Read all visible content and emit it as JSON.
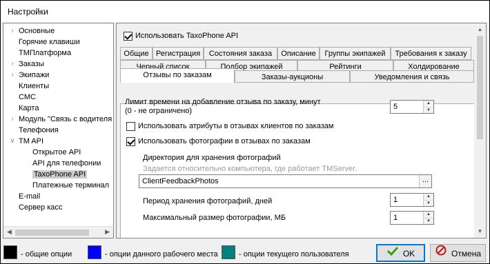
{
  "window": {
    "title": "Настройки"
  },
  "tree": {
    "items": [
      {
        "label": "Основные",
        "expandable": true,
        "expanded": false
      },
      {
        "label": "Горячие клавиши",
        "expandable": false
      },
      {
        "label": "TMПлатформа",
        "expandable": false
      },
      {
        "label": "Заказы",
        "expandable": true,
        "expanded": false
      },
      {
        "label": "Экипажи",
        "expandable": true,
        "expanded": false
      },
      {
        "label": "Клиенты",
        "expandable": false
      },
      {
        "label": "СМС",
        "expandable": false
      },
      {
        "label": "Карта",
        "expandable": false
      },
      {
        "label": "Модуль \"Связь с водителя",
        "expandable": true,
        "expanded": false
      },
      {
        "label": "Телефония",
        "expandable": false
      },
      {
        "label": "TM API",
        "expandable": true,
        "expanded": true
      },
      {
        "label": "Открытое API",
        "expandable": false,
        "child": true
      },
      {
        "label": "API для телефонии",
        "expandable": false,
        "child": true
      },
      {
        "label": "TaxoPhone API",
        "expandable": false,
        "child": true,
        "selected": true
      },
      {
        "label": "Платежные терминал",
        "expandable": false,
        "child": true
      },
      {
        "label": "E-mail",
        "expandable": false
      },
      {
        "label": "Сервер касс",
        "expandable": false
      }
    ]
  },
  "panel": {
    "use_api": {
      "label": "Использовать TaxoPhone API",
      "checked": true
    },
    "tabs_row1": [
      "Общие",
      "Регистрация",
      "Состояния заказа",
      "Описание",
      "Группы экипажей",
      "Требования к заказу"
    ],
    "tabs_row2": [
      "Черный список",
      "Подбор экипажей",
      "Рейтинги",
      "Холдирование"
    ],
    "tabs_row3": [
      "Отзывы по заказам",
      "Заказы-аукционы",
      "Уведомления и связь"
    ],
    "active_tab": "Отзывы по заказам",
    "review_time_limit": {
      "label_line1": "Лимит времени на добавление отзыва по заказу, минут",
      "label_line2": "(0 - не ограничено)",
      "value": "5"
    },
    "use_attributes": {
      "label": "Использовать атрибуты в отзывах клиентов по заказам",
      "checked": false
    },
    "use_photos": {
      "label": "Использовать фотографии в отзывах по заказам",
      "checked": true
    },
    "photo_dir": {
      "label": "Директория для хранения фотографий",
      "hint": "Задается относительно  компьютера, где работает TMServer.",
      "value": "ClientFeedbackPhotos",
      "browse_label": "..."
    },
    "photo_retention": {
      "label": "Период хранения фотографий, дней",
      "value": "1"
    },
    "photo_max_size": {
      "label": "Максимальный размер фотографии, МБ",
      "value": "1"
    }
  },
  "legend": [
    {
      "color": "#000000",
      "label": "- общие опции"
    },
    {
      "color": "#0000ff",
      "label": "- опции данного рабочего места"
    },
    {
      "color": "#008080",
      "label": "- опции текущего пользователя"
    }
  ],
  "buttons": {
    "ok": {
      "label": "OK",
      "icon": "checkmark-icon",
      "icon_color": "#3c9a1e"
    },
    "cancel": {
      "label": "Отмена",
      "icon": "cancel-icon",
      "icon_color": "#c01515"
    }
  }
}
